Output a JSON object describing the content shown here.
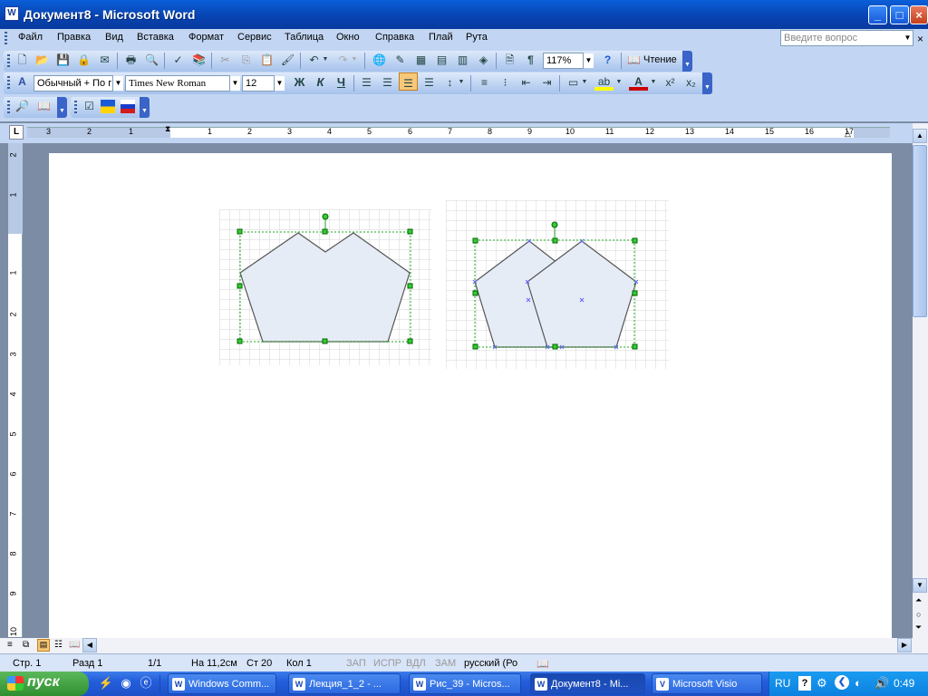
{
  "window": {
    "title": "Документ8 - Microsoft Word",
    "app_icon": "W"
  },
  "menu": [
    "Файл",
    "Правка",
    "Вид",
    "Вставка",
    "Формат",
    "Сервис",
    "Таблица",
    "Окно",
    "Справка",
    "Плай",
    "Рута"
  ],
  "ask": {
    "placeholder": "Введите вопрос"
  },
  "toolbar1": {
    "zoom": "117%",
    "read_label": "Чтение"
  },
  "formatting": {
    "style": "Обычный + По г",
    "font": "Times New Roman",
    "size": "12",
    "bold": "Ж",
    "italic": "К",
    "underline": "Ч"
  },
  "ruler": {
    "h_labels": [
      "3",
      "2",
      "1",
      "1",
      "2",
      "3",
      "4",
      "5",
      "6",
      "7",
      "8",
      "9",
      "10",
      "11",
      "12",
      "13",
      "14",
      "15",
      "16",
      "17"
    ],
    "v_labels": [
      "2",
      "1",
      "1",
      "2",
      "3",
      "4",
      "5",
      "6",
      "7",
      "8",
      "9",
      "10"
    ]
  },
  "status": {
    "page": "Стр. 1",
    "section": "Разд 1",
    "pages": "1/1",
    "at": "На 11,2см",
    "line": "Ст 20",
    "col": "Кол 1",
    "rec": "ЗАП",
    "trk": "ИСПР",
    "ext": "ВДЛ",
    "ovr": "ЗАМ",
    "lang": "русский (Ро"
  },
  "taskbar": {
    "start": "пуск",
    "buttons": [
      {
        "label": "Windows Comm...",
        "icon": "W"
      },
      {
        "label": "Лекция_1_2 - ...",
        "icon": "W"
      },
      {
        "label": "Рис_39 - Micros...",
        "icon": "W"
      },
      {
        "label": "Документ8 - Mi...",
        "icon": "W"
      },
      {
        "label": "Microsoft Visio",
        "icon": "V"
      }
    ],
    "lang": "RU",
    "clock": "0:49"
  },
  "colors": {
    "title_bar": "#0842b0",
    "shape_fill": "#e6ecf6",
    "selection_handle": "#1fa51f",
    "taskbar": "#245edb",
    "start": "#2f8f2f"
  }
}
